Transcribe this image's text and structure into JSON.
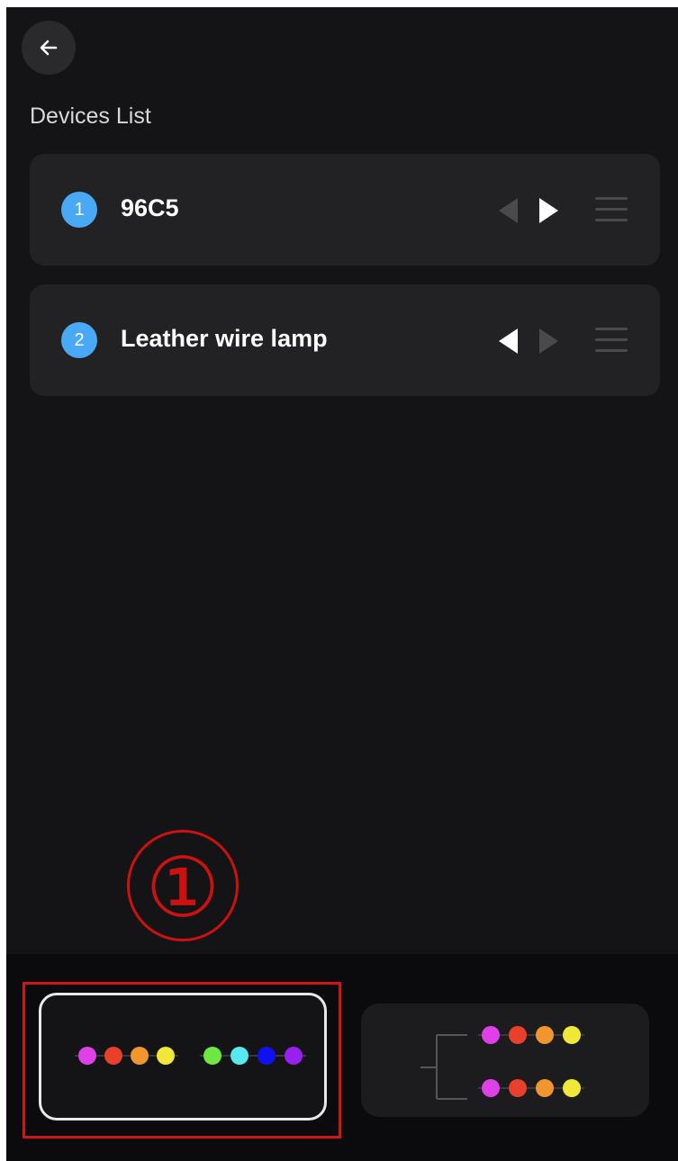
{
  "header": {
    "back_icon": "arrow-left-icon"
  },
  "section_title": "Devices List",
  "devices": [
    {
      "index": "1",
      "name": "96C5",
      "left_arrow_active": false,
      "right_arrow_active": true
    },
    {
      "index": "2",
      "name": "Leather wire lamp",
      "left_arrow_active": true,
      "right_arrow_active": false
    }
  ],
  "annotation": {
    "label": "①",
    "color": "#cc1111"
  },
  "connection_modes": [
    {
      "id": "series",
      "selected": true,
      "colors": [
        "#e040e8",
        "#e8402a",
        "#f0962e",
        "#f0e838",
        "#6ee840",
        "#58e8f0",
        "#1010f0",
        "#9820f0"
      ]
    },
    {
      "id": "parallel",
      "selected": false,
      "colors": [
        "#e040e8",
        "#e8402a",
        "#f0962e",
        "#f0e838"
      ]
    }
  ],
  "colors": {
    "background": "#141416",
    "card": "#222224",
    "badge": "#4aa9f4",
    "inactive_arrow": "#4a4a4c"
  }
}
